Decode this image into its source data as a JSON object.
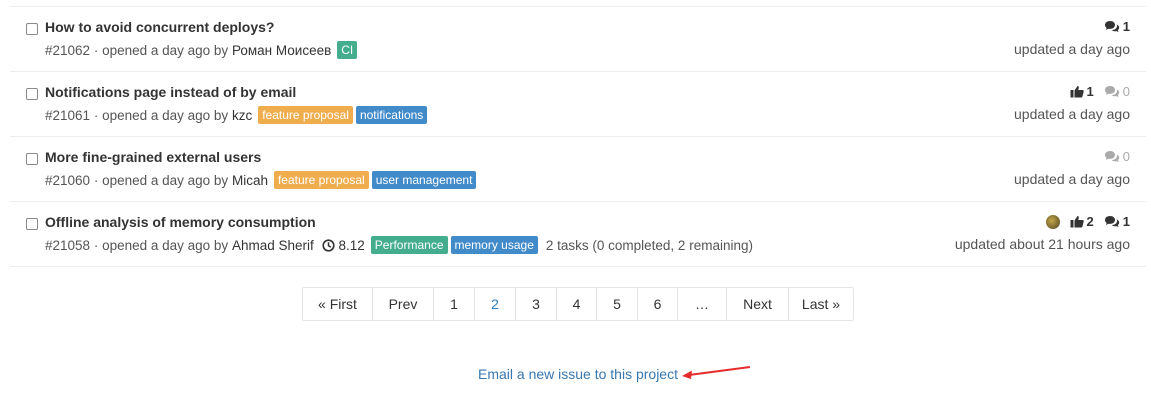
{
  "colors": {
    "label_ci": "#44ad8e",
    "label_feature_proposal": "#f0ad4e",
    "label_blue": "#428bca",
    "label_performance": "#44ad8e",
    "link": "#3777b0",
    "arrow": "#e52b2b"
  },
  "issues": [
    {
      "title": "How to avoid concurrent deploys?",
      "id": "#21062",
      "opened": "· opened a day ago by",
      "author": "Роман Моисеев",
      "labels": [
        "CI"
      ],
      "updated": "updated a day ago",
      "comments": "1"
    },
    {
      "title": "Notifications page instead of by email",
      "id": "#21061",
      "opened": "· opened a day ago by",
      "author": "kzc",
      "labels": [
        "feature proposal",
        "notifications"
      ],
      "updated": "updated a day ago",
      "upvotes": "1",
      "comments": "0"
    },
    {
      "title": "More fine-grained external users",
      "id": "#21060",
      "opened": "· opened a day ago by",
      "author": "Micah",
      "labels": [
        "feature proposal",
        "user management"
      ],
      "updated": "updated a day ago",
      "comments": "0"
    },
    {
      "title": "Offline analysis of memory consumption",
      "id": "#21058",
      "opened": "· opened a day ago by",
      "author": "Ahmad Sherif",
      "milestone": "8.12",
      "labels": [
        "Performance",
        "memory usage"
      ],
      "tasks": "2 tasks (0 completed, 2 remaining)",
      "updated": "updated about 21 hours ago",
      "upvotes": "2",
      "comments": "1"
    }
  ],
  "pagination": {
    "first": "« First",
    "prev": "Prev",
    "pages": [
      "1",
      "2",
      "3",
      "4",
      "5",
      "6"
    ],
    "ellipsis": "…",
    "next": "Next",
    "last": "Last »",
    "current": "2"
  },
  "email_link": "Email a new issue to this project"
}
